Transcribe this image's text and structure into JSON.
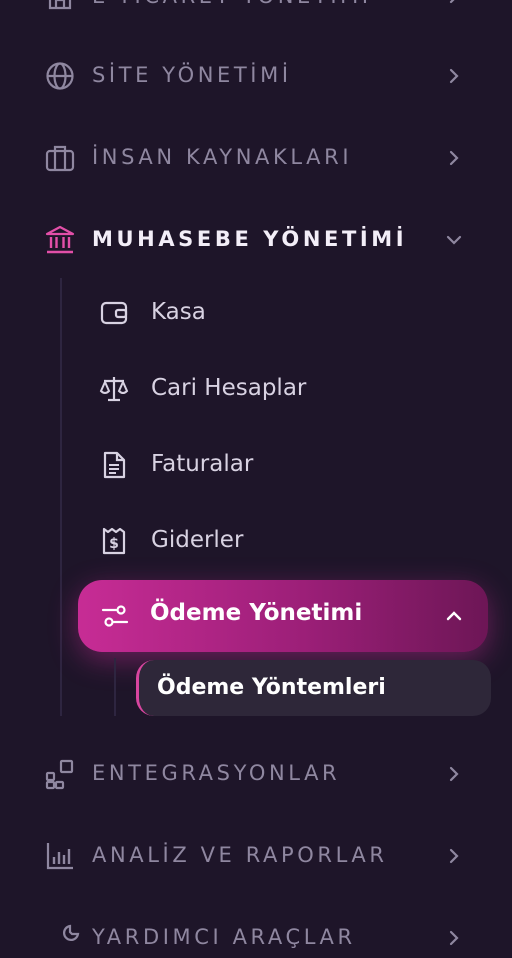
{
  "sections": {
    "top": {
      "label": "E-TİCARET YÖNETİMİ",
      "icon": "store-icon"
    },
    "site": {
      "label": "SİTE YÖNETİMİ",
      "icon": "globe-icon"
    },
    "hr": {
      "label": "İNSAN KAYNAKLARI",
      "icon": "briefcase-icon"
    },
    "accounting": {
      "label": "MUHASEBE YÖNETİMİ",
      "icon": "bank-icon",
      "expanded": true
    },
    "integrations": {
      "label": "ENTEGRASYONLAR",
      "icon": "puzzle-icon"
    },
    "analytics": {
      "label": "ANALİZ VE RAPORLAR",
      "icon": "bar-chart-icon"
    },
    "tools": {
      "label": "YARDIMCI ARAÇLAR",
      "icon": "tools-icon"
    }
  },
  "accounting_items": {
    "kasa": {
      "label": "Kasa",
      "icon": "wallet-icon"
    },
    "cari": {
      "label": "Cari Hesaplar",
      "icon": "scale-icon"
    },
    "fatura": {
      "label": "Faturalar",
      "icon": "document-icon"
    },
    "gider": {
      "label": "Giderler",
      "icon": "receipt-icon"
    },
    "odeme": {
      "label": "Ödeme Yönetimi",
      "icon": "sliders-icon",
      "active": true,
      "children": {
        "yontem": {
          "label": "Ödeme Yöntemleri",
          "active": true
        }
      }
    }
  },
  "colors": {
    "bg": "#1e1529",
    "accent": "#c72c95",
    "muted": "#8f87a0",
    "icon_pink": "#e24fa8"
  }
}
